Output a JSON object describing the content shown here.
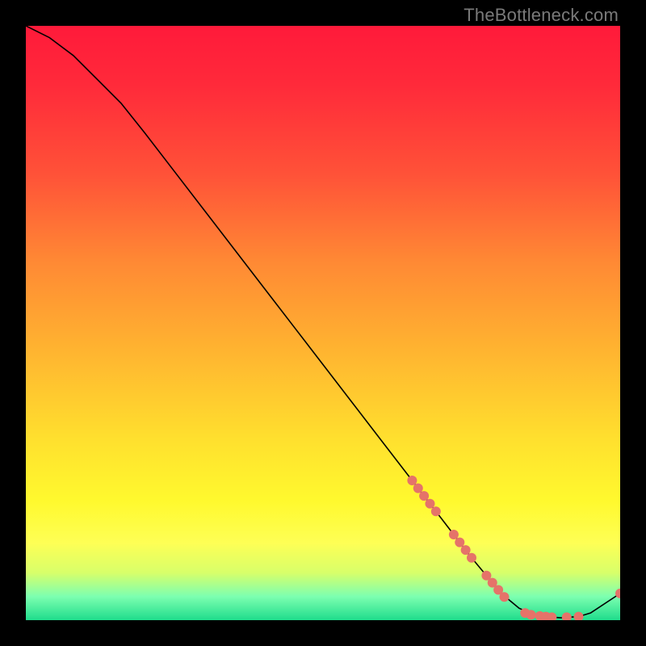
{
  "attribution": "TheBottleneck.com",
  "chart_data": {
    "type": "line",
    "title": "",
    "xlabel": "",
    "ylabel": "",
    "xlim": [
      0,
      100
    ],
    "ylim": [
      0,
      100
    ],
    "series": [
      {
        "name": "curve",
        "x": [
          0,
          4,
          8,
          12,
          16,
          20,
          25,
          30,
          35,
          40,
          45,
          50,
          55,
          60,
          65,
          70,
          75,
          80,
          83,
          86,
          90,
          93,
          95,
          100
        ],
        "values": [
          100,
          98,
          95,
          91,
          87,
          82,
          75.5,
          69,
          62.5,
          56,
          49.5,
          43,
          36.5,
          30,
          23.5,
          17,
          10.5,
          4.5,
          2,
          0.7,
          0.4,
          0.6,
          1.2,
          4.5
        ]
      }
    ],
    "markers": {
      "name": "highlighted-points",
      "color": "#e57369",
      "points": [
        {
          "x": 65,
          "y": 23.5
        },
        {
          "x": 66,
          "y": 22.2
        },
        {
          "x": 67,
          "y": 20.9
        },
        {
          "x": 68,
          "y": 19.6
        },
        {
          "x": 69,
          "y": 18.3
        },
        {
          "x": 72,
          "y": 14.4
        },
        {
          "x": 73,
          "y": 13.1
        },
        {
          "x": 74,
          "y": 11.8
        },
        {
          "x": 75,
          "y": 10.5
        },
        {
          "x": 77.5,
          "y": 7.5
        },
        {
          "x": 78.5,
          "y": 6.3
        },
        {
          "x": 79.5,
          "y": 5.1
        },
        {
          "x": 80.5,
          "y": 3.9
        },
        {
          "x": 84,
          "y": 1.2
        },
        {
          "x": 85,
          "y": 0.9
        },
        {
          "x": 86.5,
          "y": 0.7
        },
        {
          "x": 87.5,
          "y": 0.6
        },
        {
          "x": 88.5,
          "y": 0.5
        },
        {
          "x": 91,
          "y": 0.5
        },
        {
          "x": 93,
          "y": 0.6
        },
        {
          "x": 100,
          "y": 4.5
        }
      ]
    }
  }
}
